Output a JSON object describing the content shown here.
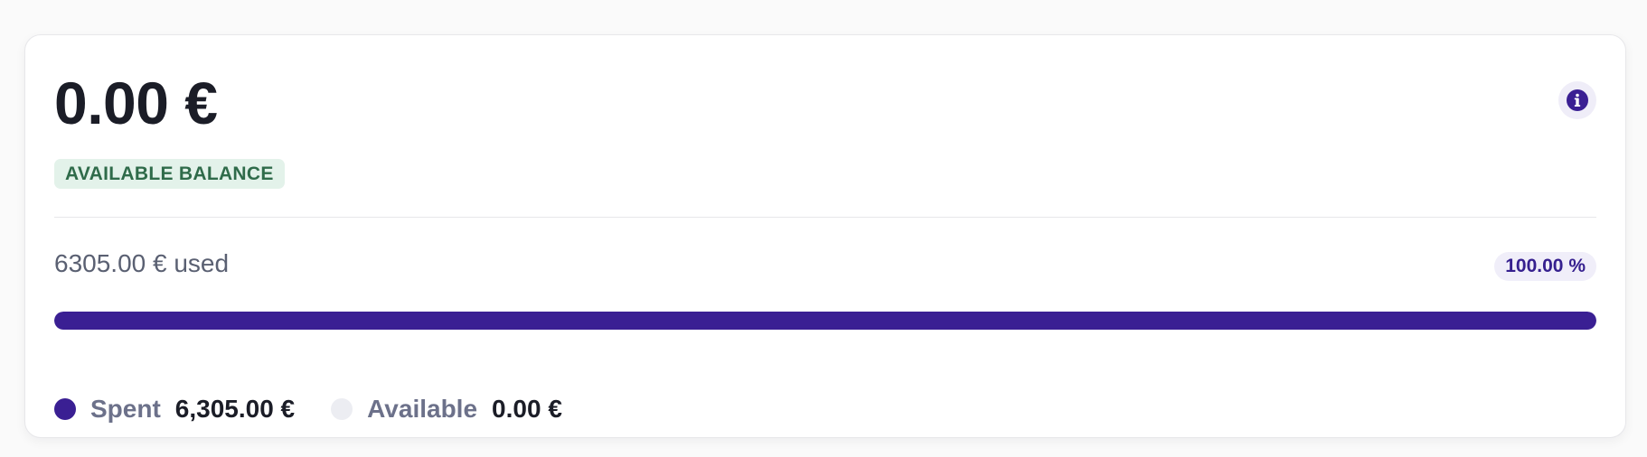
{
  "balance": {
    "amount": "0.00 €",
    "badge_label": "AVAILABLE BALANCE",
    "info_icon": "info-icon"
  },
  "usage": {
    "used_text": "6305.00 € used",
    "percent_text": "100.00 %",
    "progress_fraction": 1.0
  },
  "legend": [
    {
      "label": "Spent",
      "value": "6,305.00 €",
      "color": "#3a1f93"
    },
    {
      "label": "Available",
      "value": "0.00 €",
      "color": "#ecedf2"
    }
  ],
  "colors": {
    "accent": "#3a1f93",
    "badge_bg": "#e3f2ea",
    "badge_text": "#2f6b4a"
  }
}
